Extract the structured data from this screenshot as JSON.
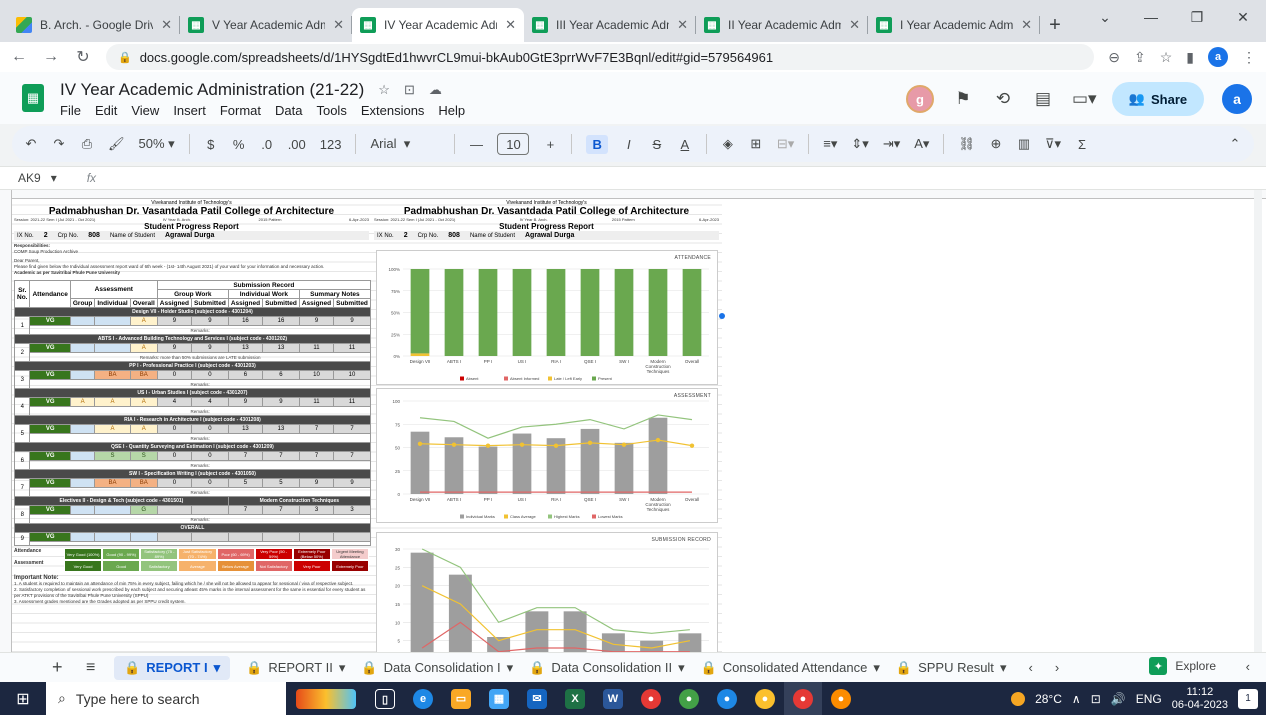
{
  "browser": {
    "tabs": [
      {
        "title": "B. Arch. - Google Driv",
        "icon": "drive-icon",
        "active": false
      },
      {
        "title": "V Year Academic Adm",
        "icon": "sheets-icon",
        "active": false
      },
      {
        "title": "IV Year Academic Adm",
        "icon": "sheets-icon",
        "active": true
      },
      {
        "title": "III Year Academic Adm",
        "icon": "sheets-icon",
        "active": false
      },
      {
        "title": "II Year Academic Adm",
        "icon": "sheets-icon",
        "active": false
      },
      {
        "title": "I Year Academic Admi",
        "icon": "sheets-icon",
        "active": false
      }
    ],
    "url": "docs.google.com/spreadsheets/d/1HYSgdtEd1hwvrCL9mui-bkAub0GtE3prrWvF7E3Bqnl/edit#gid=579564961",
    "profile_initial": "a"
  },
  "sheets": {
    "doc_title": "IV Year Academic Administration (21-22)",
    "menus": [
      "File",
      "Edit",
      "View",
      "Insert",
      "Format",
      "Data",
      "Tools",
      "Extensions",
      "Help"
    ],
    "collaborator_initial": "g",
    "share_label": "Share",
    "user_initial": "a",
    "toolbar": {
      "zoom": "50%",
      "currency": "$",
      "percent": "%",
      "dec_minus": ".0",
      "dec_plus": ".00",
      "number_format": "123",
      "font": "Arial",
      "font_size": "10",
      "bold": "B",
      "italic": "I",
      "strike": "S",
      "text_color": "A"
    },
    "cell_ref": "AK9",
    "fx": "fx"
  },
  "report": {
    "institute": "Vivekanand Institute of Technology's",
    "college": "Padmabhushan Dr. Vasantdada Patil College of Architecture",
    "session": "Session: 2021-22 Sem I (Jul 2021 - Oct 2021)",
    "year": "IV Year B. Arch.",
    "pattern": "2015 Pattern",
    "date": "6-Apr-2023",
    "title": "Student Progress Report",
    "ix_label": "IX No.",
    "ix_value": "2",
    "crp_label": "Crp No.",
    "crp_value": "808",
    "name_label": "Name of Student",
    "name_value": "Agrawal Durga",
    "responsibilities": "Responsibilities:",
    "resp_detail": "COMP Soup Production Archive",
    "dear": "Dear Parent,",
    "intro": "Please find given below the Individual assessment report ward of 6th week - (1st- 14th August 2021) of your ward for your information and necessary action.",
    "intro2": "Academic as per Savitribai Phule Pune University",
    "headers": {
      "sr": "Sr. No.",
      "attendance": "Attendance",
      "assessment": "Assessment",
      "submission": "Submission Record",
      "group_work": "Group Work",
      "individual_work": "Individual Work",
      "summary_notes": "Summary Notes",
      "group": "Group",
      "individual": "Individual",
      "overall": "Overall",
      "assigned": "Assigned",
      "submitted": "Submitted"
    },
    "remarks_label": "Remarks:",
    "subjects": [
      {
        "sr": "1",
        "name": "Design VII - Holder Studio (subject code - 4301204)",
        "att": "VG",
        "grp": "",
        "ind": "",
        "ovr": "A",
        "ga": "9",
        "gs": "9",
        "ia": "16",
        "is": "16",
        "sa": "9",
        "ss": "9",
        "remark": ""
      },
      {
        "sr": "2",
        "name": "ABTS I - Advanced Building Technology and Services I (subject code - 4301202)",
        "att": "VG",
        "grp": "",
        "ind": "",
        "ovr": "A",
        "ga": "9",
        "gs": "9",
        "ia": "13",
        "is": "13",
        "sa": "11",
        "ss": "11",
        "remark": "more than 50% submissions are LATE submission"
      },
      {
        "sr": "3",
        "name": "PP I - Professional Practice I (subject code - 4301203)",
        "att": "VG",
        "grp": "",
        "ind": "BA",
        "ovr": "BA",
        "ga": "0",
        "gs": "0",
        "ia": "6",
        "is": "6",
        "sa": "10",
        "ss": "10",
        "remark": ""
      },
      {
        "sr": "4",
        "name": "US I - Urban Studies I (subject code - 4301207)",
        "att": "VG",
        "grp": "A",
        "ind": "A",
        "ovr": "A",
        "ga": "4",
        "gs": "4",
        "ia": "9",
        "is": "9",
        "sa": "11",
        "ss": "11",
        "remark": ""
      },
      {
        "sr": "5",
        "name": "RIA I - Research in Architecture I (subject code - 4301208)",
        "att": "VG",
        "grp": "",
        "ind": "A",
        "ovr": "A",
        "ga": "0",
        "gs": "0",
        "ia": "13",
        "is": "13",
        "sa": "7",
        "ss": "7",
        "remark": ""
      },
      {
        "sr": "6",
        "name": "QSE I - Quantity Surveying and Estimation I (subject code - 4301209)",
        "att": "VG",
        "grp": "",
        "ind": "S",
        "ovr": "S",
        "ga": "0",
        "gs": "0",
        "ia": "7",
        "is": "7",
        "sa": "7",
        "ss": "7",
        "remark": ""
      },
      {
        "sr": "7",
        "name": "SW I - Specification Writing I (subject code - 4301050)",
        "att": "VG",
        "grp": "",
        "ind": "BA",
        "ovr": "BA",
        "ga": "0",
        "gs": "0",
        "ia": "5",
        "is": "5",
        "sa": "9",
        "ss": "9",
        "remark": ""
      },
      {
        "sr": "8",
        "name": "Electives II - Design & Tech (subject code - 4301501)",
        "elective": "Modern Construction Techniques",
        "att": "VG",
        "grp": "",
        "ind": "",
        "ovr": "G",
        "ga": "",
        "gs": "",
        "ia": "7",
        "is": "7",
        "sa": "3",
        "ss": "3",
        "remark": ""
      },
      {
        "sr": "9",
        "name": "OVERALL",
        "att": "VG",
        "grp": "",
        "ind": "",
        "ovr": "",
        "ga": "",
        "gs": "",
        "ia": "",
        "is": "",
        "sa": "",
        "ss": "",
        "remark": ""
      }
    ],
    "legend_att_label": "Attendance",
    "legend_asmt_label": "Assessment",
    "legend_att": [
      "Very Good (100%)",
      "Good (90 - 99%)",
      "Satisfactory (75 - 89%)",
      "Just Satisfactory (70 - 74%)",
      "Poor (60 - 69%)",
      "Very Poor (50 - 59%)",
      "Extremely Poor (Below 50%)",
      "Urgent Meeting Attendance"
    ],
    "legend_asmt": [
      "Very Good",
      "Good",
      "Satisfactory",
      "Average",
      "Below Average",
      "Not Satisfactory",
      "Very Poor",
      "Extremely Poor"
    ],
    "note_title": "Important Note:",
    "notes": [
      "1. A student is required to maintain an attendance of min 75% in every subject, failing which he / she will not be allowed to appear for sessional / viva of respective subject.",
      "2. Satisfactory completion of sessional work prescribed by each subject and securing atleast 45% marks in the internal assessment for the same is essential for every student as per ATKT provisions of the Savitribai Phule Pune University (SPPU)",
      "3. Assessment grades mentioned are the Grades adopted as per SPPU credit system."
    ]
  },
  "chart_data": [
    {
      "type": "bar",
      "title": "ATTENDANCE",
      "categories": [
        "Design VII",
        "ABTS I",
        "PP I",
        "US I",
        "RIA I",
        "QSE I",
        "SW I",
        "Modern Construction Techniques",
        "Overall"
      ],
      "series": [
        {
          "name": "Absent",
          "values": [
            0,
            0,
            0,
            0,
            0,
            0,
            0,
            0,
            0
          ],
          "color": "#cc0000"
        },
        {
          "name": "Absent Informed",
          "values": [
            0,
            0,
            0,
            0,
            0,
            0,
            0,
            0,
            0
          ],
          "color": "#e06666"
        },
        {
          "name": "Late / Left Early",
          "values": [
            3,
            0,
            0,
            0,
            0,
            0,
            0,
            0,
            0
          ],
          "color": "#f1c232"
        },
        {
          "name": "Present",
          "values": [
            97,
            100,
            100,
            100,
            100,
            100,
            100,
            100,
            100
          ],
          "color": "#6aa84f"
        }
      ],
      "y_ticks": [
        "0%",
        "25%",
        "50%",
        "75%",
        "100%"
      ],
      "ylim": [
        0,
        100
      ],
      "stacked": true,
      "legend": "bottom"
    },
    {
      "type": "bar",
      "title": "ASSESSMENT",
      "categories": [
        "Design VII",
        "ABTS I",
        "PP I",
        "US I",
        "RIA I",
        "QSE I",
        "SW I",
        "Modern Construction Techniques",
        "Overall"
      ],
      "series": [
        {
          "name": "Individual Marks",
          "kind": "bar",
          "values": [
            67,
            61,
            51,
            65,
            60,
            70,
            55,
            82,
            null
          ],
          "color": "#9e9e9e"
        },
        {
          "name": "Class Average",
          "kind": "line",
          "values": [
            54,
            53,
            52,
            53,
            52,
            55,
            53,
            58,
            52
          ],
          "color": "#f1c232"
        },
        {
          "name": "Highest Marks",
          "kind": "line",
          "values": [
            82,
            78,
            60,
            72,
            75,
            80,
            70,
            85,
            80
          ],
          "color": "#93c47d"
        },
        {
          "name": "Lowest Marks",
          "kind": "line",
          "values": [
            2,
            2,
            2,
            2,
            2,
            2,
            2,
            2,
            2
          ],
          "color": "#e06666"
        }
      ],
      "y_ticks": [
        "0",
        "25",
        "50",
        "75",
        "100"
      ],
      "ylim": [
        0,
        100
      ],
      "legend": "bottom"
    },
    {
      "type": "bar",
      "title": "SUBMISSION RECORD",
      "categories": [
        "Design VII",
        "ABTS I",
        "PP I",
        "US I",
        "RIA I",
        "QSE I",
        "SW I",
        "Modern Construction Techniques"
      ],
      "series": [
        {
          "name": "Submitted",
          "kind": "bar",
          "values": [
            29,
            23,
            6,
            13,
            13,
            7,
            5,
            7
          ],
          "color": "#9e9e9e"
        },
        {
          "name": "Highest",
          "kind": "line",
          "values": [
            30,
            25,
            10,
            14,
            14,
            8,
            7,
            8
          ],
          "color": "#93c47d"
        },
        {
          "name": "Class Average",
          "kind": "line",
          "values": [
            20,
            15,
            5,
            8,
            8,
            4,
            3,
            5
          ],
          "color": "#f1c232"
        },
        {
          "name": "Lowest",
          "kind": "line",
          "values": [
            3,
            10,
            2,
            3,
            3,
            2,
            2,
            2
          ],
          "color": "#e06666"
        }
      ],
      "y_ticks": [
        "0",
        "5",
        "10",
        "15",
        "20",
        "25",
        "30"
      ],
      "ylim": [
        0,
        30
      ]
    }
  ],
  "sheet_tabs": [
    {
      "label": "REPORT I",
      "active": true
    },
    {
      "label": "REPORT II",
      "active": false
    },
    {
      "label": "Data Consolidation I",
      "active": false
    },
    {
      "label": "Data Consolidation II",
      "active": false
    },
    {
      "label": "Consolidated Attendance",
      "active": false
    },
    {
      "label": "SPPU Result",
      "active": false
    }
  ],
  "explore_label": "Explore",
  "taskbar": {
    "search_placeholder": "Type here to search",
    "temperature": "28°C",
    "language": "ENG",
    "time": "11:12",
    "date": "06-04-2023",
    "notifications": "1"
  }
}
